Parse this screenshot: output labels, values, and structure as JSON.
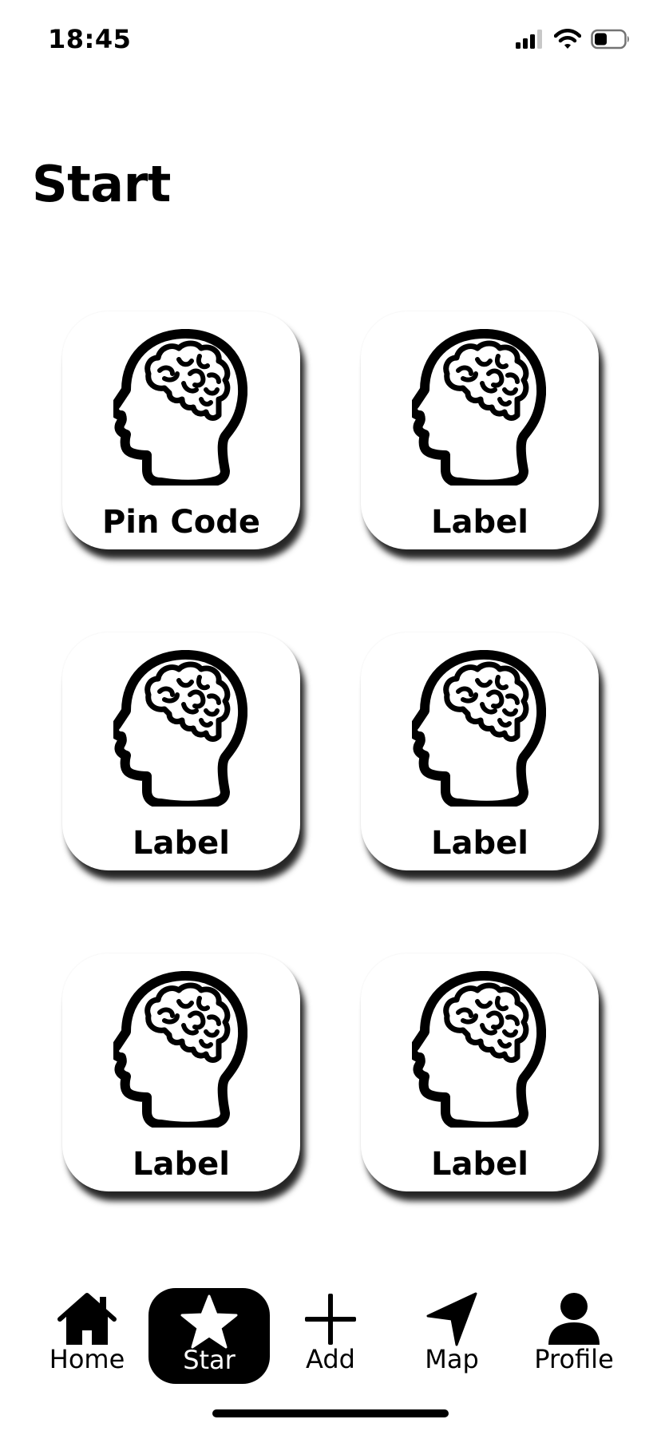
{
  "status_bar": {
    "time": "18:45",
    "icons": [
      "cellular-signal-icon",
      "wifi-icon",
      "battery-icon"
    ]
  },
  "page": {
    "title": "Start"
  },
  "tiles": [
    {
      "label": "Pin Code",
      "icon": "brain-head-icon"
    },
    {
      "label": "Label",
      "icon": "brain-head-icon"
    },
    {
      "label": "Label",
      "icon": "brain-head-icon"
    },
    {
      "label": "Label",
      "icon": "brain-head-icon"
    },
    {
      "label": "Label",
      "icon": "brain-head-icon"
    },
    {
      "label": "Label",
      "icon": "brain-head-icon"
    }
  ],
  "tab_bar": {
    "active": "Star",
    "items": [
      {
        "label": "Home",
        "icon": "home-icon"
      },
      {
        "label": "Star",
        "icon": "star-icon"
      },
      {
        "label": "Add",
        "icon": "plus-icon"
      },
      {
        "label": "Map",
        "icon": "location-arrow-icon"
      },
      {
        "label": "Profile",
        "icon": "person-icon"
      }
    ]
  },
  "colors": {
    "background": "#ffffff",
    "foreground": "#000000",
    "active_tab_background": "#000000",
    "active_tab_foreground": "#ffffff"
  }
}
